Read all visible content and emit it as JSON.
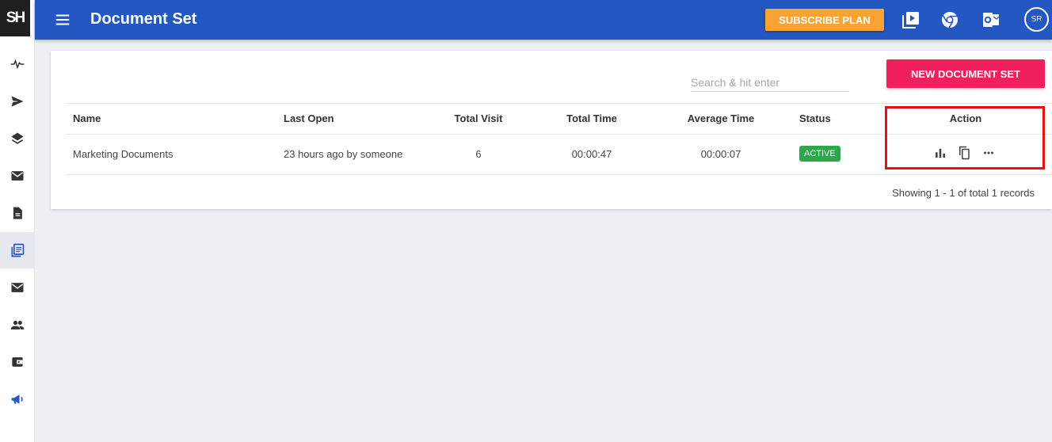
{
  "logo": "SH",
  "header": {
    "title": "Document Set",
    "subscribe_label": "SUBSCRIBE PLAN",
    "avatar_initials": "SR"
  },
  "sidebar": {
    "items": [
      {
        "icon": "activity-icon"
      },
      {
        "icon": "send-icon"
      },
      {
        "icon": "layers-icon"
      },
      {
        "icon": "inbox-icon"
      },
      {
        "icon": "document-icon"
      },
      {
        "icon": "document-set-icon",
        "active": true
      },
      {
        "icon": "mail-icon"
      },
      {
        "icon": "people-icon"
      },
      {
        "icon": "wallet-icon"
      },
      {
        "icon": "megaphone-icon"
      }
    ]
  },
  "toolbar": {
    "search_placeholder": "Search & hit enter",
    "new_button_label": "NEW DOCUMENT SET"
  },
  "table": {
    "columns": [
      "Name",
      "Last Open",
      "Total Visit",
      "Total Time",
      "Average Time",
      "Status",
      "Action"
    ],
    "rows": [
      {
        "name": "Marketing Documents",
        "last_open": "23 hours ago by someone",
        "total_visit": "6",
        "total_time": "00:00:47",
        "average_time": "00:00:07",
        "status": "ACTIVE"
      }
    ],
    "records_text": "Showing 1 - 1 of total 1 records"
  },
  "colors": {
    "header": "#2357c1",
    "subscribe": "#f9a334",
    "new_button": "#f0205f",
    "status_active": "#2aa84a",
    "highlight": "#e51010"
  }
}
